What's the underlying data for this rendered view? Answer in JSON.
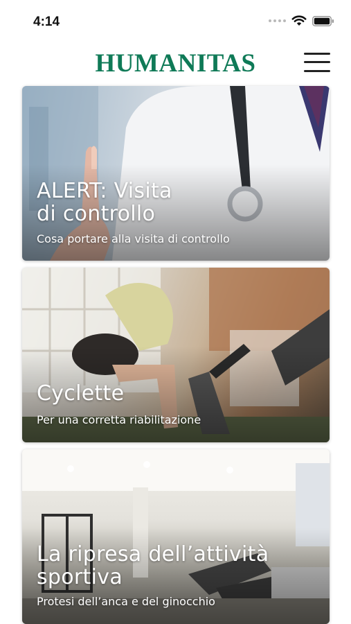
{
  "status_bar": {
    "time": "4:14"
  },
  "header": {
    "logo": "HUMANITAS"
  },
  "cards": [
    {
      "title_line1": "ALERT: Visita",
      "title_line2": "di controllo",
      "subtitle": "Cosa portare alla visita di controllo"
    },
    {
      "title_line1": "Cyclette",
      "title_line2": "",
      "subtitle": "Per una corretta riabilitazione"
    },
    {
      "title_line1": "La ripresa dell’attività",
      "title_line2": "sportiva",
      "subtitle": "Protesi dell’anca e del ginocchio"
    }
  ]
}
